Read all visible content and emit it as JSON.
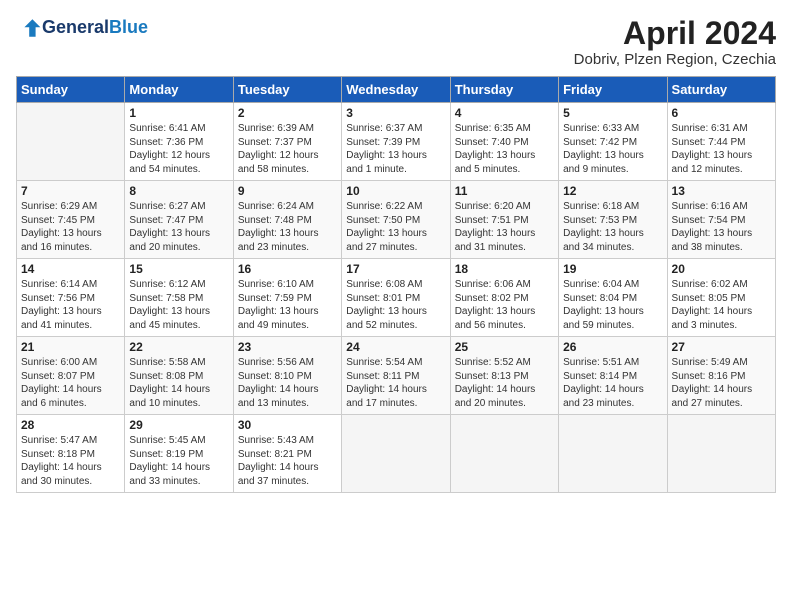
{
  "logo": {
    "line1": "General",
    "line2": "Blue"
  },
  "title": "April 2024",
  "location": "Dobriv, Plzen Region, Czechia",
  "days_of_week": [
    "Sunday",
    "Monday",
    "Tuesday",
    "Wednesday",
    "Thursday",
    "Friday",
    "Saturday"
  ],
  "weeks": [
    [
      {
        "day": "",
        "info": ""
      },
      {
        "day": "1",
        "info": "Sunrise: 6:41 AM\nSunset: 7:36 PM\nDaylight: 12 hours\nand 54 minutes."
      },
      {
        "day": "2",
        "info": "Sunrise: 6:39 AM\nSunset: 7:37 PM\nDaylight: 12 hours\nand 58 minutes."
      },
      {
        "day": "3",
        "info": "Sunrise: 6:37 AM\nSunset: 7:39 PM\nDaylight: 13 hours\nand 1 minute."
      },
      {
        "day": "4",
        "info": "Sunrise: 6:35 AM\nSunset: 7:40 PM\nDaylight: 13 hours\nand 5 minutes."
      },
      {
        "day": "5",
        "info": "Sunrise: 6:33 AM\nSunset: 7:42 PM\nDaylight: 13 hours\nand 9 minutes."
      },
      {
        "day": "6",
        "info": "Sunrise: 6:31 AM\nSunset: 7:44 PM\nDaylight: 13 hours\nand 12 minutes."
      }
    ],
    [
      {
        "day": "7",
        "info": "Sunrise: 6:29 AM\nSunset: 7:45 PM\nDaylight: 13 hours\nand 16 minutes."
      },
      {
        "day": "8",
        "info": "Sunrise: 6:27 AM\nSunset: 7:47 PM\nDaylight: 13 hours\nand 20 minutes."
      },
      {
        "day": "9",
        "info": "Sunrise: 6:24 AM\nSunset: 7:48 PM\nDaylight: 13 hours\nand 23 minutes."
      },
      {
        "day": "10",
        "info": "Sunrise: 6:22 AM\nSunset: 7:50 PM\nDaylight: 13 hours\nand 27 minutes."
      },
      {
        "day": "11",
        "info": "Sunrise: 6:20 AM\nSunset: 7:51 PM\nDaylight: 13 hours\nand 31 minutes."
      },
      {
        "day": "12",
        "info": "Sunrise: 6:18 AM\nSunset: 7:53 PM\nDaylight: 13 hours\nand 34 minutes."
      },
      {
        "day": "13",
        "info": "Sunrise: 6:16 AM\nSunset: 7:54 PM\nDaylight: 13 hours\nand 38 minutes."
      }
    ],
    [
      {
        "day": "14",
        "info": "Sunrise: 6:14 AM\nSunset: 7:56 PM\nDaylight: 13 hours\nand 41 minutes."
      },
      {
        "day": "15",
        "info": "Sunrise: 6:12 AM\nSunset: 7:58 PM\nDaylight: 13 hours\nand 45 minutes."
      },
      {
        "day": "16",
        "info": "Sunrise: 6:10 AM\nSunset: 7:59 PM\nDaylight: 13 hours\nand 49 minutes."
      },
      {
        "day": "17",
        "info": "Sunrise: 6:08 AM\nSunset: 8:01 PM\nDaylight: 13 hours\nand 52 minutes."
      },
      {
        "day": "18",
        "info": "Sunrise: 6:06 AM\nSunset: 8:02 PM\nDaylight: 13 hours\nand 56 minutes."
      },
      {
        "day": "19",
        "info": "Sunrise: 6:04 AM\nSunset: 8:04 PM\nDaylight: 13 hours\nand 59 minutes."
      },
      {
        "day": "20",
        "info": "Sunrise: 6:02 AM\nSunset: 8:05 PM\nDaylight: 14 hours\nand 3 minutes."
      }
    ],
    [
      {
        "day": "21",
        "info": "Sunrise: 6:00 AM\nSunset: 8:07 PM\nDaylight: 14 hours\nand 6 minutes."
      },
      {
        "day": "22",
        "info": "Sunrise: 5:58 AM\nSunset: 8:08 PM\nDaylight: 14 hours\nand 10 minutes."
      },
      {
        "day": "23",
        "info": "Sunrise: 5:56 AM\nSunset: 8:10 PM\nDaylight: 14 hours\nand 13 minutes."
      },
      {
        "day": "24",
        "info": "Sunrise: 5:54 AM\nSunset: 8:11 PM\nDaylight: 14 hours\nand 17 minutes."
      },
      {
        "day": "25",
        "info": "Sunrise: 5:52 AM\nSunset: 8:13 PM\nDaylight: 14 hours\nand 20 minutes."
      },
      {
        "day": "26",
        "info": "Sunrise: 5:51 AM\nSunset: 8:14 PM\nDaylight: 14 hours\nand 23 minutes."
      },
      {
        "day": "27",
        "info": "Sunrise: 5:49 AM\nSunset: 8:16 PM\nDaylight: 14 hours\nand 27 minutes."
      }
    ],
    [
      {
        "day": "28",
        "info": "Sunrise: 5:47 AM\nSunset: 8:18 PM\nDaylight: 14 hours\nand 30 minutes."
      },
      {
        "day": "29",
        "info": "Sunrise: 5:45 AM\nSunset: 8:19 PM\nDaylight: 14 hours\nand 33 minutes."
      },
      {
        "day": "30",
        "info": "Sunrise: 5:43 AM\nSunset: 8:21 PM\nDaylight: 14 hours\nand 37 minutes."
      },
      {
        "day": "",
        "info": ""
      },
      {
        "day": "",
        "info": ""
      },
      {
        "day": "",
        "info": ""
      },
      {
        "day": "",
        "info": ""
      }
    ]
  ]
}
